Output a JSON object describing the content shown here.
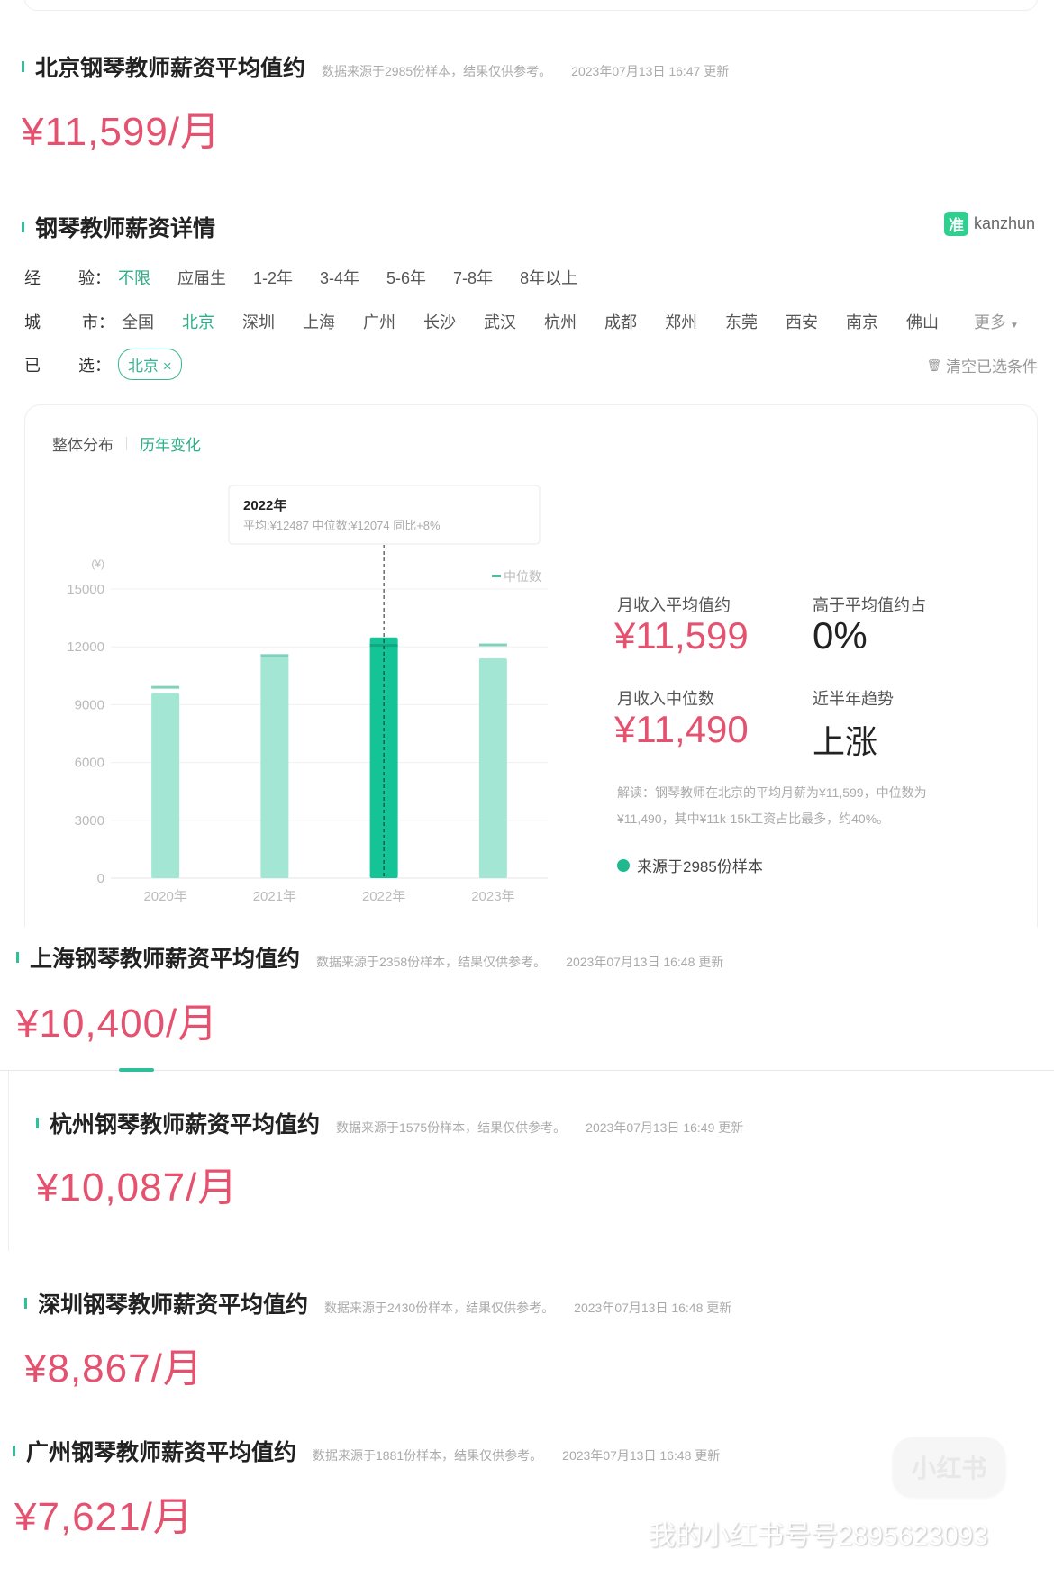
{
  "sections": [
    {
      "title": "北京钢琴教师薪资平均值约",
      "meta": "数据来源于2985份样本，结果仅供参考。",
      "date": "2023年07月13日 16:47 更新",
      "price": "¥11,599/月"
    },
    {
      "title": "上海钢琴教师薪资平均值约",
      "meta": "数据来源于2358份样本，结果仅供参考。",
      "date": "2023年07月13日 16:48 更新",
      "price": "¥10,400/月"
    },
    {
      "title": "杭州钢琴教师薪资平均值约",
      "meta": "数据来源于1575份样本，结果仅供参考。",
      "date": "2023年07月13日 16:49 更新",
      "price": "¥10,087/月"
    },
    {
      "title": "深圳钢琴教师薪资平均值约",
      "meta": "数据来源于2430份样本，结果仅供参考。",
      "date": "2023年07月13日 16:48 更新",
      "price": "¥8,867/月"
    },
    {
      "title": "广州钢琴教师薪资平均值约",
      "meta": "数据来源于1881份样本，结果仅供参考。",
      "date": "2023年07月13日 16:48 更新",
      "price": "¥7,621/月"
    }
  ],
  "detail": {
    "title": "钢琴教师薪资详情",
    "logo_mark": "准",
    "logo_word": "kanzhun",
    "exp_label": [
      "经",
      "验："
    ],
    "exp_options": [
      "不限",
      "应届生",
      "1-2年",
      "3-4年",
      "5-6年",
      "7-8年",
      "8年以上"
    ],
    "city_label": [
      "城",
      "市："
    ],
    "city_options": [
      "全国",
      "北京",
      "深圳",
      "上海",
      "广州",
      "长沙",
      "武汉",
      "杭州",
      "成都",
      "郑州",
      "东莞",
      "西安",
      "南京",
      "佛山"
    ],
    "more": "更多",
    "sel_label": [
      "已",
      "选："
    ],
    "selected_chip": "北京 ×",
    "clear": "清空已选条件"
  },
  "tabs": [
    "整体分布",
    "历年变化"
  ],
  "stats": {
    "avg_label": "月收入平均值约",
    "avg_value": "¥11,599",
    "above_label": "高于平均值约占",
    "above_value": "0%",
    "median_label": "月收入中位数",
    "median_value": "¥11,490",
    "trend_label": "近半年趋势",
    "trend_value": "上涨",
    "explain": "解读：钢琴教师在北京的平均月薪为¥11,599，中位数为¥11,490，其中¥11k-15k工资占比最多，约40%。",
    "source": "来源于2985份样本"
  },
  "chart_data": {
    "type": "bar",
    "categories": [
      "2020年",
      "2021年",
      "2022年",
      "2023年"
    ],
    "series": [
      {
        "name": "平均",
        "values": [
          9600,
          11500,
          12487,
          11400
        ]
      },
      {
        "name": "中位数",
        "values": [
          9900,
          11550,
          12074,
          12100
        ]
      }
    ],
    "ylabel": "(¥)",
    "yticks": [
      "15000",
      "12000",
      "9000",
      "6000",
      "3000",
      "0"
    ],
    "ylim": [
      0,
      15000
    ],
    "legend": "中位数",
    "legend_position": "top-right",
    "highlight_index": 2,
    "tooltip": {
      "title": "2022年",
      "body": "平均:¥12487  中位数:¥12074  同比+8%"
    },
    "colors": {
      "bar": "#a3e6d4",
      "bar_active": "#14c497",
      "median": "#4cbfa0"
    }
  },
  "watermark": {
    "badge": "小红书",
    "text": "我的小红书号号2895623093"
  }
}
